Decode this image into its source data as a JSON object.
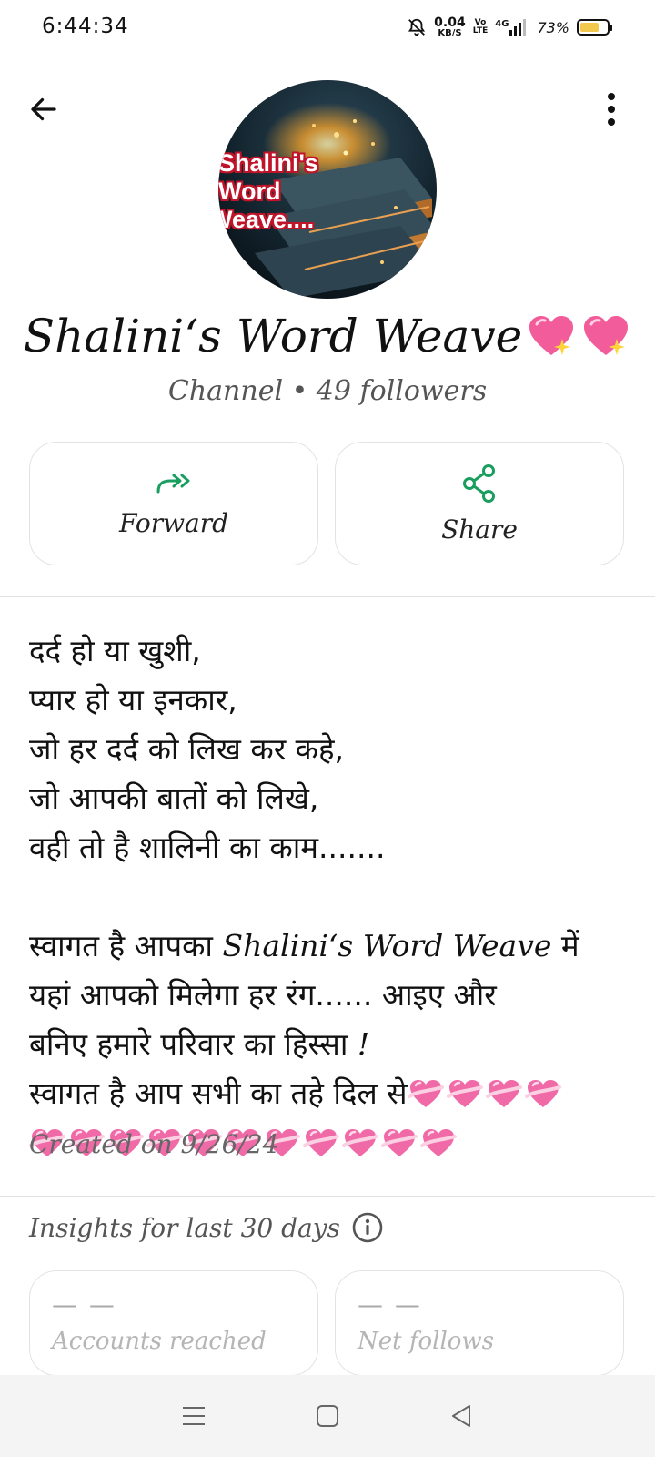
{
  "status_bar": {
    "time": "6:44:34",
    "net_speed_value": "0.04",
    "net_speed_unit": "KB/S",
    "volte_top": "Vo",
    "volte_bottom": "LTE",
    "network": "4G",
    "battery_percent": "73%",
    "battery_level": 0.73
  },
  "header": {
    "back_icon": "arrow-left-icon",
    "more_icon": "more-vertical-icon"
  },
  "avatar": {
    "text_lines": [
      "Shalini's",
      "Word",
      "Weave...."
    ]
  },
  "channel": {
    "name": "Shalini‘s Word Weave",
    "name_emoji": "sparkling-heart",
    "meta": "Channel • 49 followers"
  },
  "actions": {
    "forward_label": "Forward",
    "forward_icon": "forward-arrows-icon",
    "share_label": "Share",
    "share_icon": "share-icon",
    "accent_color": "#1a9e5f"
  },
  "description": {
    "poem_lines": [
      "दर्द हो या खुशी,",
      "प्यार हो या इनकार,",
      "जो हर दर्द को लिख कर कहे,",
      "जो आपकी बातों को लिखे,",
      "वही तो है शालिनी का काम......."
    ],
    "welcome_prefix": "स्वागत है आपका ",
    "welcome_name": "Shalini‘s Word Weave",
    "welcome_suffix": " में",
    "line2": "यहां आपको मिलेगा हर रंग...... आइए और",
    "line3_prefix": "बनिए हमारे परिवार का हिस्सा ",
    "line3_mark": "!",
    "line4": "स्वागत है आप सभी का तहे दिल से",
    "heart_emoji": "heart-with-ribbon",
    "hearts_line4": 4,
    "hearts_line5": 11,
    "created": "Created on 9/26/24"
  },
  "insights": {
    "title": "Insights for last 30 days",
    "info_icon": "info-icon",
    "cards": [
      {
        "value": "— —",
        "label": "Accounts reached"
      },
      {
        "value": "— —",
        "label": "Net follows"
      }
    ]
  },
  "nav": {
    "menu_icon": "menu-icon",
    "home_icon": "home-square-icon",
    "back_icon": "back-triangle-icon"
  }
}
